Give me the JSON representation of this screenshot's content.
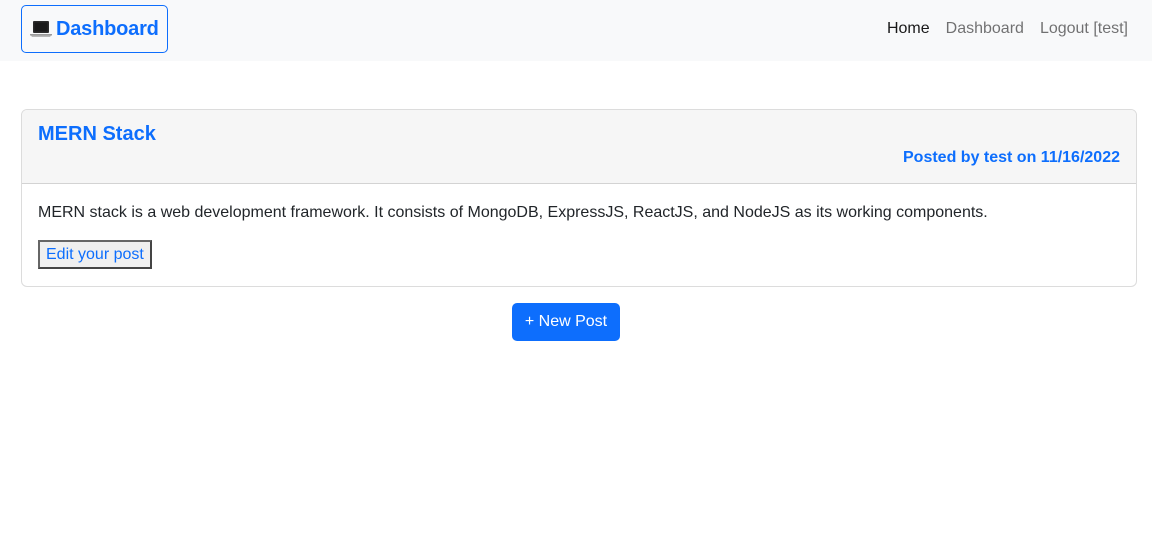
{
  "navbar": {
    "brand": {
      "icon": "laptop-icon",
      "label": "Dashboard"
    },
    "links": [
      {
        "label": "Home",
        "active": true
      },
      {
        "label": "Dashboard",
        "active": false
      },
      {
        "label": "Logout [test]",
        "active": false
      }
    ]
  },
  "post": {
    "title": "MERN Stack",
    "meta": "Posted by test on 11/16/2022",
    "content": "MERN stack is a web development framework. It consists of MongoDB, ExpressJS, ReactJS, and NodeJS as its working components.",
    "edit_label": "Edit your post"
  },
  "actions": {
    "new_post_label": "+ New Post"
  },
  "colors": {
    "accent": "#0d6efd",
    "navbar_bg": "#f8f9fa",
    "card_header_bg": "#f6f6f6"
  }
}
